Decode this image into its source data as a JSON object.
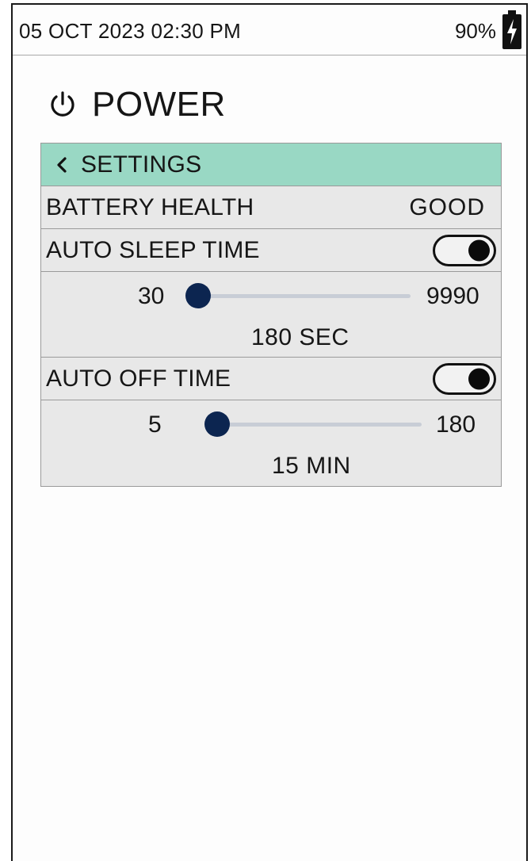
{
  "status_bar": {
    "datetime": "05 OCT 2023 02:30 PM",
    "battery_percent": "90%",
    "battery_icon": "battery-charging-icon"
  },
  "header": {
    "icon": "power-icon",
    "title": "POWER"
  },
  "settings_panel": {
    "back_icon": "chevron-left-icon",
    "back_label": "SETTINGS",
    "accent_color": "#99d8c4",
    "battery_health": {
      "label": "BATTERY HEALTH",
      "value": "GOOD"
    },
    "auto_sleep": {
      "label": "AUTO SLEEP TIME",
      "enabled": true,
      "min_label": "30",
      "max_label": "9990",
      "value": 180,
      "readout": "180 SEC"
    },
    "auto_off": {
      "label": "AUTO OFF TIME",
      "enabled": true,
      "min_label": "5",
      "max_label": "180",
      "value": 15,
      "readout": "15 MIN"
    }
  }
}
